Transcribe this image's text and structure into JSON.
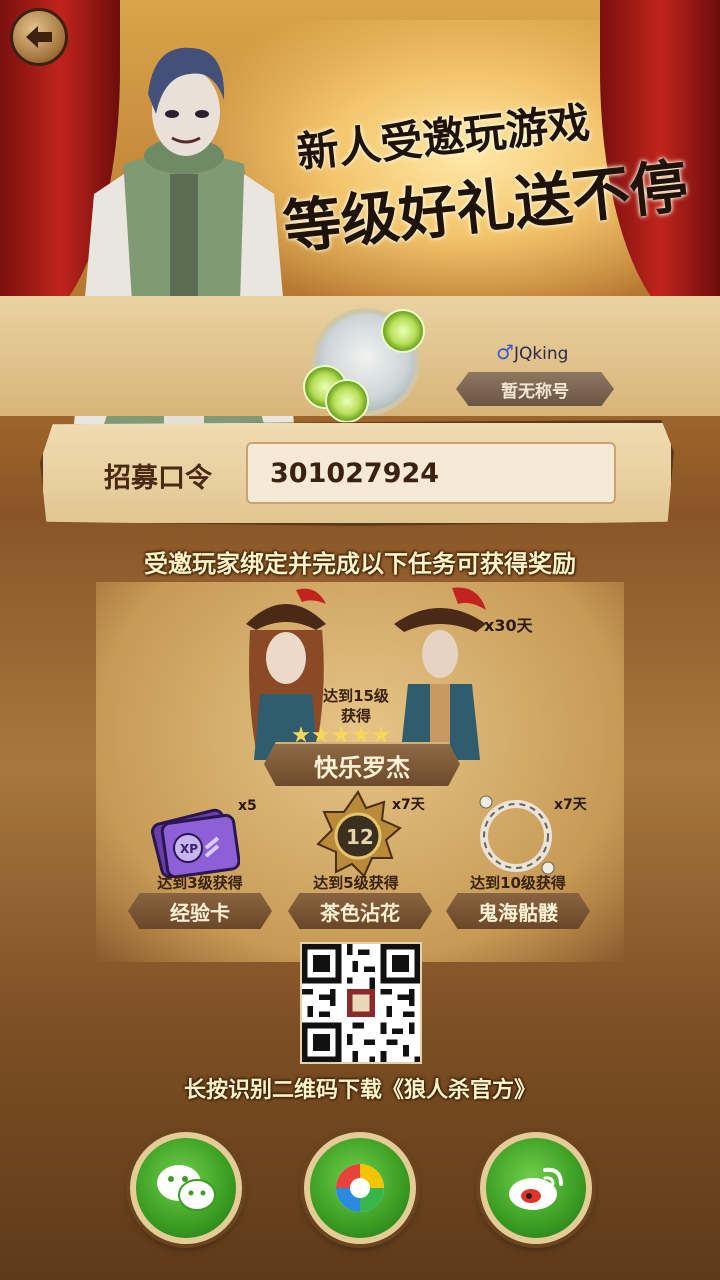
{
  "header": {
    "back_icon": "back-arrow-icon",
    "title_line1": "新人受邀玩游戏",
    "title_line2": "等级好礼送不停"
  },
  "player": {
    "gender_symbol": "♂",
    "name": "JQking",
    "title_badge": "暂无称号"
  },
  "invite": {
    "label": "招募口令",
    "code": "301027924"
  },
  "tasks": {
    "heading": "受邀玩家绑定并完成以下任务可获得奖励",
    "main_reward": {
      "requirement_line1": "达到15级",
      "requirement_line2": "获得",
      "duration": "x30天",
      "name": "快乐罗杰",
      "stars": 5
    },
    "rewards": [
      {
        "icon": "xp-card-icon",
        "count": "x5",
        "requirement": "达到3级获得",
        "name": "经验卡"
      },
      {
        "icon": "badge-12-icon",
        "count": "x7天",
        "requirement": "达到5级获得",
        "name": "茶色沾花"
      },
      {
        "icon": "bone-ring-icon",
        "count": "x7天",
        "requirement": "达到10级获得",
        "name": "鬼海骷髅"
      }
    ]
  },
  "download": {
    "qr_icon": "qr-code-icon",
    "caption": "长按识别二维码下载《狼人杀官方》"
  },
  "share": [
    {
      "icon": "wechat-icon"
    },
    {
      "icon": "moments-icon"
    },
    {
      "icon": "weibo-icon"
    }
  ],
  "colors": {
    "curtain": "#c0241c",
    "panel": "#e2c691",
    "text_dark": "#3b2210",
    "share_green": "#3a9c22"
  }
}
